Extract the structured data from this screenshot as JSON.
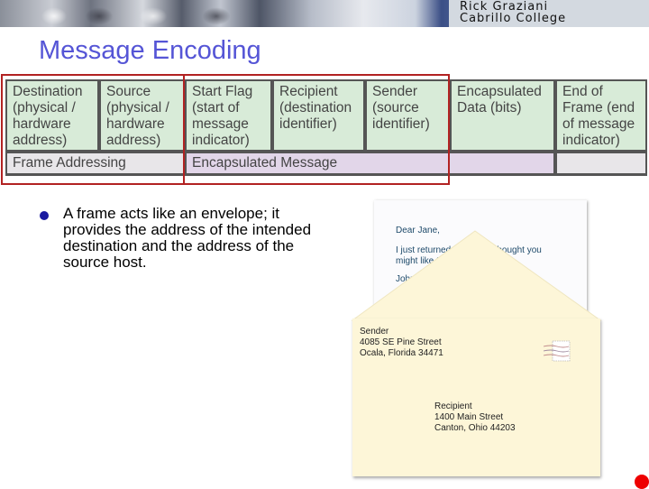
{
  "header": {
    "author_line1": "Rick Graziani",
    "author_line2": "Cabrillo College"
  },
  "slide": {
    "title": "Message Encoding"
  },
  "frame_table": {
    "fields": [
      {
        "label": "Destination (physical / hardware address)"
      },
      {
        "label": "Source (physical / hardware address)"
      },
      {
        "label": "Start Flag (start of message indicator)"
      },
      {
        "label": "Recipient (destination identifier)"
      },
      {
        "label": "Sender (source identifier)"
      },
      {
        "label": "Encapsulated Data (bits)"
      },
      {
        "label": "End of Frame (end of message indicator)"
      }
    ],
    "groups": [
      {
        "label": "Frame Addressing",
        "color": "#e8e6e9"
      },
      {
        "label": "Encapsulated Message",
        "color": "#e2d6e9"
      },
      {
        "label": "",
        "color": "#e8e6e9"
      }
    ],
    "field_color": "#d8ebd8",
    "highlight_color": "#b22222"
  },
  "bullets": [
    {
      "text": "A frame acts like an envelope; it provides the address of the intended destination and the address of the source host."
    }
  ],
  "illustration": {
    "letter": {
      "greeting": "Dear Jane,",
      "body_line1": "I just returned f",
      "body_line1b": "I thought you",
      "body_line2": "might like t",
      "signature": "John"
    },
    "envelope": {
      "sender_label": "Sender",
      "sender_street": "4085 SE Pine Street",
      "sender_city": "Ocala, Florida 34471",
      "recipient_label": "Recipient",
      "recipient_street": "1400 Main Street",
      "recipient_city": "Canton, Ohio 44203"
    }
  }
}
